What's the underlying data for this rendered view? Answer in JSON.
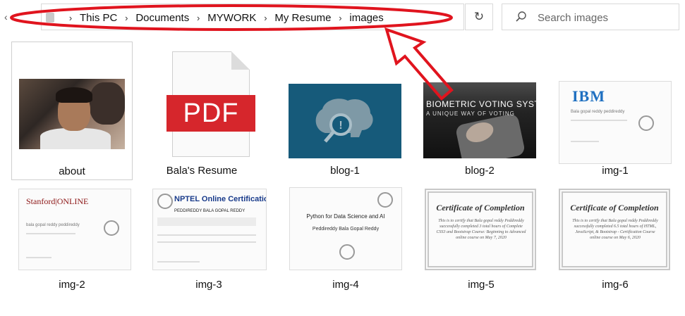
{
  "toolbar": {
    "path": [
      "This PC",
      "Documents",
      "MYWORK",
      "My Resume",
      "images"
    ],
    "separator": "›",
    "refresh_glyph": "↻",
    "back_glyph": "‹"
  },
  "search": {
    "placeholder": "Search images",
    "icon": "search-icon"
  },
  "files": [
    {
      "name": "about",
      "kind": "photo",
      "selected": true
    },
    {
      "name": "Bala's Resume",
      "kind": "pdf",
      "badge": "PDF"
    },
    {
      "name": "blog-1",
      "kind": "image"
    },
    {
      "name": "blog-2",
      "kind": "image",
      "title": "BIOMETRIC VOTING SYSTEM",
      "subtitle": "A UNIQUE WAY OF VOTING"
    },
    {
      "name": "img-1",
      "kind": "image",
      "logo": "IBM",
      "recipient": "Bala gopal reddy peddireddy"
    },
    {
      "name": "img-2",
      "kind": "image",
      "logo": "Stanford|ONLINE",
      "recipient": "bala gopal reddy peddireddy"
    },
    {
      "name": "img-3",
      "kind": "image",
      "title": "NPTEL Online Certification",
      "recipient": "PEDDIREDDY BALA GOPAL REDDY"
    },
    {
      "name": "img-4",
      "kind": "image",
      "title": "Python for Data Science and AI",
      "recipient": "Peddireddy Bala Gopal Reddy"
    },
    {
      "name": "img-5",
      "kind": "image",
      "title": "Certificate of Completion",
      "body": "This is to certify that Bala gopal reddy Peddireddy successfully completed 3 total hours of Complete CSS3 and Bootstrap Course: Beginning to Advanced online course on May 7, 2020"
    },
    {
      "name": "img-6",
      "kind": "image",
      "title": "Certificate of Completion",
      "body": "This is to certify that Bala gopal reddy Peddireddy successfully completed 6.5 total hours of HTML, JavaScript, & Bootstrap - Certification Course online course on May 6, 2020"
    }
  ],
  "colors": {
    "annotation": "#e0141e",
    "pdf_red": "#d6262c",
    "blog1_bg": "#165a7a"
  }
}
